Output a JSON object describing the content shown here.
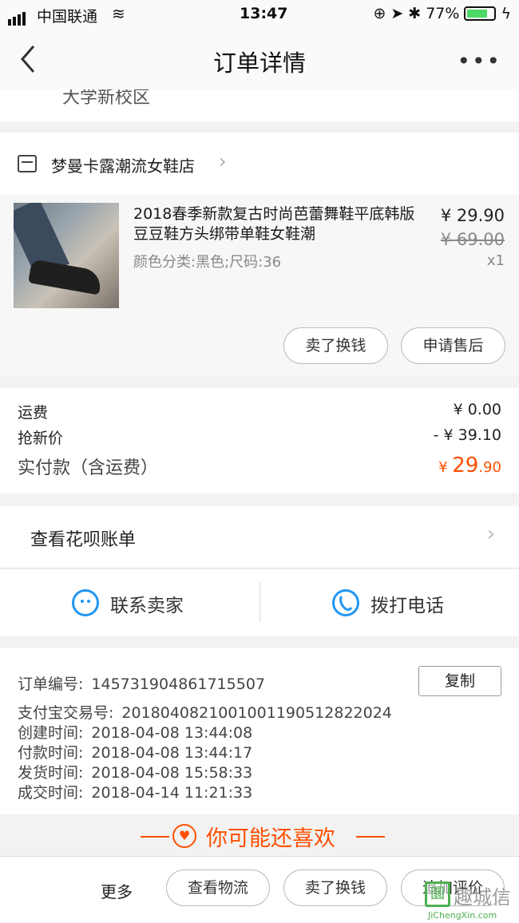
{
  "status_bar": {
    "carrier": "中国联通",
    "time": "13:47",
    "battery": "77%",
    "battery_level": 0.77
  },
  "nav": {
    "title": "订单详情",
    "more": "•••"
  },
  "address_tail": "大学新校区",
  "shop": {
    "name": "梦曼卡露潮流女鞋店"
  },
  "item": {
    "title": "2018春季新款复古时尚芭蕾舞鞋平底韩版豆豆鞋方头绑带单鞋女鞋潮",
    "spec": "颜色分类:黑色;尺码:36",
    "price": "¥ 29.90",
    "original_price": "¥ 69.00",
    "quantity": "x1",
    "actions": [
      "卖了换钱",
      "申请售后"
    ]
  },
  "fees": {
    "shipping_label": "运费",
    "shipping_value": "¥ 0.00",
    "discount_label": "抢新价",
    "discount_value": "- ¥ 39.10",
    "total_label": "实付款（含运费）",
    "total_currency": "¥ ",
    "total_int": "29",
    "total_dec": ".90"
  },
  "huabei": {
    "label": "查看花呗账单"
  },
  "contact": {
    "seller": "联系卖家",
    "phone": "拨打电话"
  },
  "order_info": {
    "order_no_label": "订单编号:",
    "order_no": "145731904861715507",
    "copy_label": "复制",
    "alipay_label": "支付宝交易号:",
    "alipay_no": "2018040821001001190512822024",
    "created_label": "创建时间:",
    "created": "2018-04-08 13:44:08",
    "paid_label": "付款时间:",
    "paid": "2018-04-08 13:44:17",
    "shipped_label": "发货时间:",
    "shipped": "2018-04-08 15:58:33",
    "completed_label": "成交时间:",
    "completed": "2018-04-14 11:21:33"
  },
  "recommend": {
    "title": "你可能还喜欢"
  },
  "bottom": {
    "more": "更多",
    "actions": [
      "查看物流",
      "卖了换钱",
      "追加评价"
    ]
  },
  "watermark": {
    "cn": "趣城信",
    "en": "JiChengXin.com",
    "box": "圜"
  },
  "colors": {
    "accent": "#ff5000",
    "link_blue": "#2196f3"
  }
}
